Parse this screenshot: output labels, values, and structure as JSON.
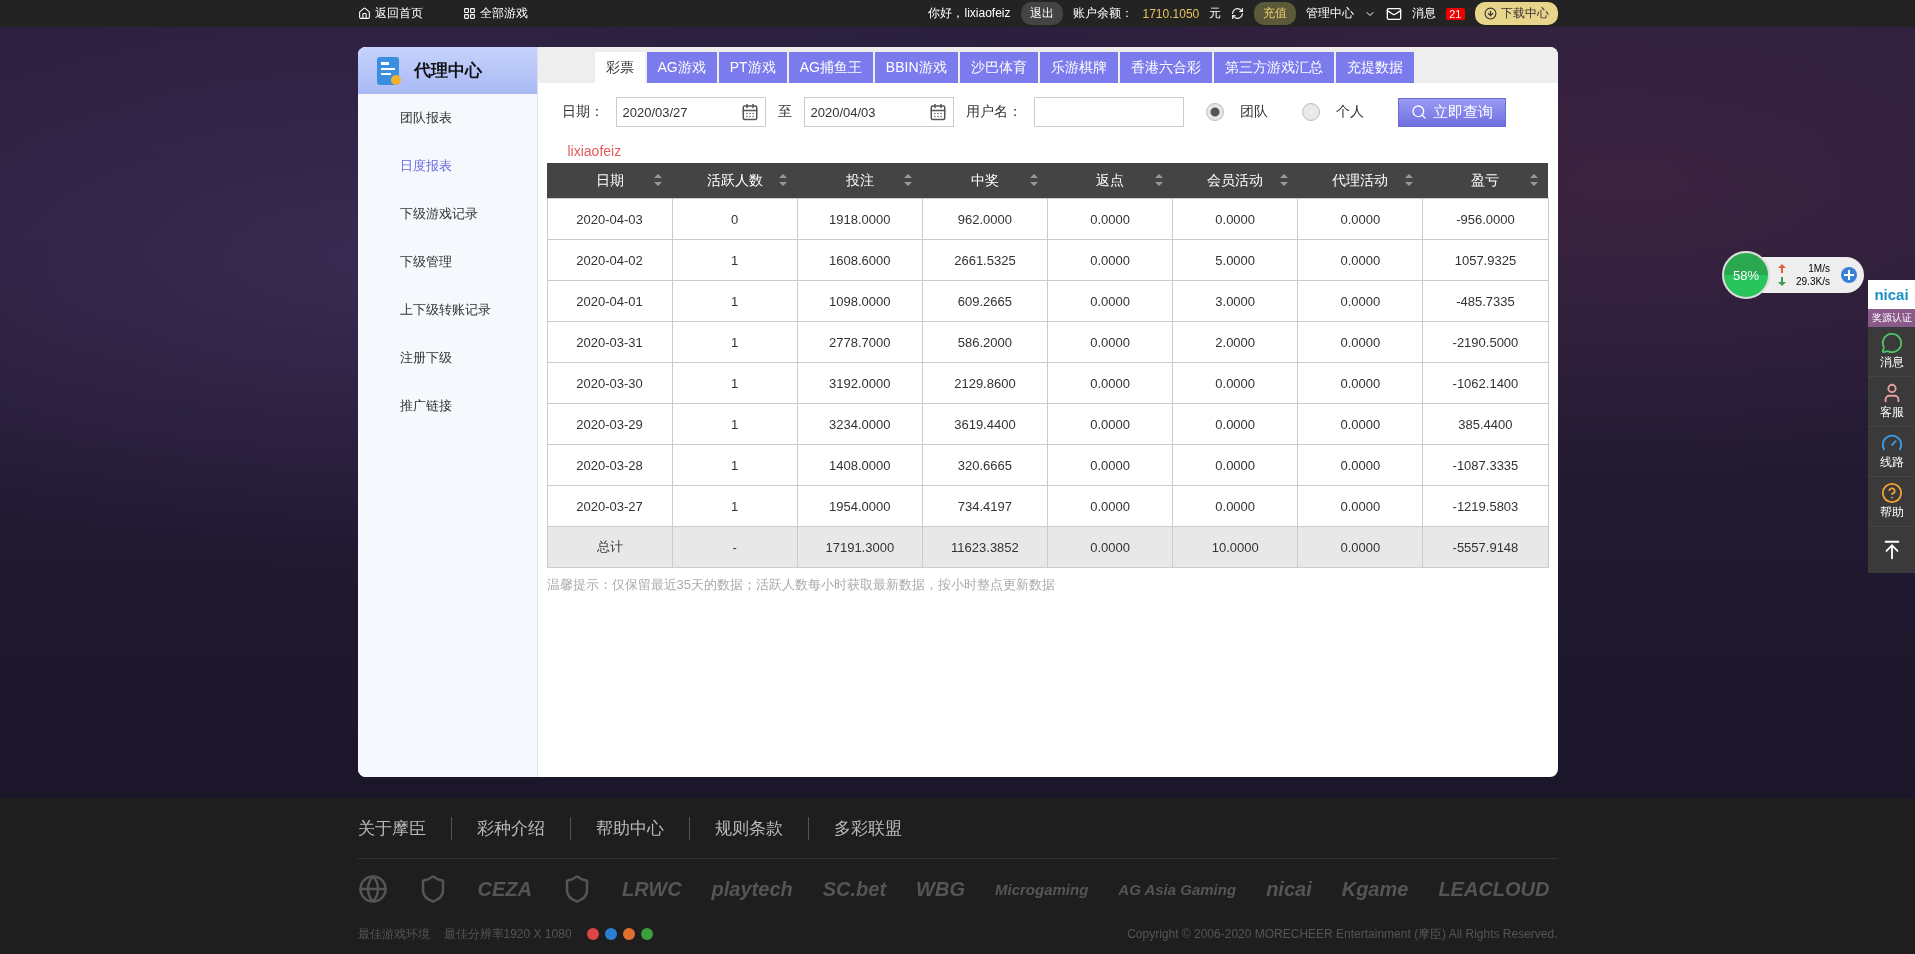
{
  "top_bar": {
    "home": "返回首页",
    "all_games": "全部游戏",
    "greeting": "你好，lixiaofeiz",
    "logout": "退出",
    "balance_label": "账户余额：",
    "balance": "1710.1050",
    "currency": "元",
    "recharge": "充值",
    "management": "管理中心",
    "messages": "消息",
    "message_count": "21",
    "download": "下载中心"
  },
  "sidebar": {
    "title": "代理中心",
    "items": [
      {
        "label": "团队报表",
        "selected": false
      },
      {
        "label": "日度报表",
        "selected": true
      },
      {
        "label": "下级游戏记录",
        "selected": false
      },
      {
        "label": "下级管理",
        "selected": false
      },
      {
        "label": "上下级转账记录",
        "selected": false
      },
      {
        "label": "注册下级",
        "selected": false
      },
      {
        "label": "推广链接",
        "selected": false
      }
    ]
  },
  "tabs": [
    {
      "label": "彩票",
      "selected": true
    },
    {
      "label": "AG游戏",
      "selected": false
    },
    {
      "label": "PT游戏",
      "selected": false
    },
    {
      "label": "AG捕鱼王",
      "selected": false
    },
    {
      "label": "BBIN游戏",
      "selected": false
    },
    {
      "label": "沙巴体育",
      "selected": false
    },
    {
      "label": "乐游棋牌",
      "selected": false
    },
    {
      "label": "香港六合彩",
      "selected": false
    },
    {
      "label": "第三方游戏汇总",
      "selected": false
    },
    {
      "label": "充提数据",
      "selected": false
    }
  ],
  "filters": {
    "date_label": "日期：",
    "start_date": "2020/03/27",
    "separator": "至",
    "end_date": "2020/04/03",
    "username_label": "用户名：",
    "scope": [
      {
        "label": "团队",
        "selected": true
      },
      {
        "label": "个人",
        "selected": false
      }
    ],
    "query": "立即查询"
  },
  "account": "lixiaofeiz",
  "table": {
    "columns": [
      "日期",
      "活跃人数",
      "投注",
      "中奖",
      "返点",
      "会员活动",
      "代理活动",
      "盈亏"
    ],
    "rows": [
      [
        "2020-04-03",
        "0",
        "1918.0000",
        "962.0000",
        "0.0000",
        "0.0000",
        "0.0000",
        "-956.0000"
      ],
      [
        "2020-04-02",
        "1",
        "1608.6000",
        "2661.5325",
        "0.0000",
        "5.0000",
        "0.0000",
        "1057.9325"
      ],
      [
        "2020-04-01",
        "1",
        "1098.0000",
        "609.2665",
        "0.0000",
        "3.0000",
        "0.0000",
        "-485.7335"
      ],
      [
        "2020-03-31",
        "1",
        "2778.7000",
        "586.2000",
        "0.0000",
        "2.0000",
        "0.0000",
        "-2190.5000"
      ],
      [
        "2020-03-30",
        "1",
        "3192.0000",
        "2129.8600",
        "0.0000",
        "0.0000",
        "0.0000",
        "-1062.1400"
      ],
      [
        "2020-03-29",
        "1",
        "3234.0000",
        "3619.4400",
        "0.0000",
        "0.0000",
        "0.0000",
        "385.4400"
      ],
      [
        "2020-03-28",
        "1",
        "1408.0000",
        "320.6665",
        "0.0000",
        "0.0000",
        "0.0000",
        "-1087.3335"
      ],
      [
        "2020-03-27",
        "1",
        "1954.0000",
        "734.4197",
        "0.0000",
        "0.0000",
        "0.0000",
        "-1219.5803"
      ]
    ],
    "total": [
      "总计",
      "-",
      "17191.3000",
      "11623.3852",
      "0.0000",
      "10.0000",
      "0.0000",
      "-5557.9148"
    ]
  },
  "note": "温馨提示：仅保留最近35天的数据；活跃人数每小时获取最新数据，按小时整点更新数据",
  "speed_widget": {
    "percent": "58%",
    "upload": "1M/s",
    "download": "29.3K/s"
  },
  "side_dock": {
    "logo": "nicai",
    "badge": "奖源认证",
    "items": [
      {
        "kind": "chat",
        "label": "消息"
      },
      {
        "kind": "service",
        "label": "客服"
      },
      {
        "kind": "route",
        "label": "线路"
      },
      {
        "kind": "help",
        "label": "帮助"
      }
    ]
  },
  "footer": {
    "links": [
      "关于摩臣",
      "彩种介绍",
      "帮助中心",
      "规则条款",
      "多彩联盟"
    ],
    "logos": [
      {
        "kind": "emblem"
      },
      {
        "kind": "emblem"
      },
      {
        "kind": "wordmark",
        "text": "CEZA"
      },
      {
        "kind": "emblem"
      },
      {
        "kind": "wordmark",
        "text": "LRWC"
      },
      {
        "kind": "wordmark",
        "text": "playtech"
      },
      {
        "kind": "wordmark",
        "text": "SC.bet"
      },
      {
        "kind": "wordmark",
        "text": "WBG"
      },
      {
        "kind": "wordmark",
        "text": "Microgaming"
      },
      {
        "kind": "wordmark",
        "text": "AG Asia Gaming"
      },
      {
        "kind": "wordmark",
        "text": "nicai"
      },
      {
        "kind": "wordmark",
        "text": "Kgame"
      },
      {
        "kind": "wordmark",
        "text": "LEACLOUD"
      }
    ],
    "environment": "最佳游戏环境",
    "resolution": "最佳分辨率1920 X 1080",
    "copyright": "Copyright © 2006-2020 MORECHEER Entertainment (摩臣) All Rights Reserved."
  }
}
